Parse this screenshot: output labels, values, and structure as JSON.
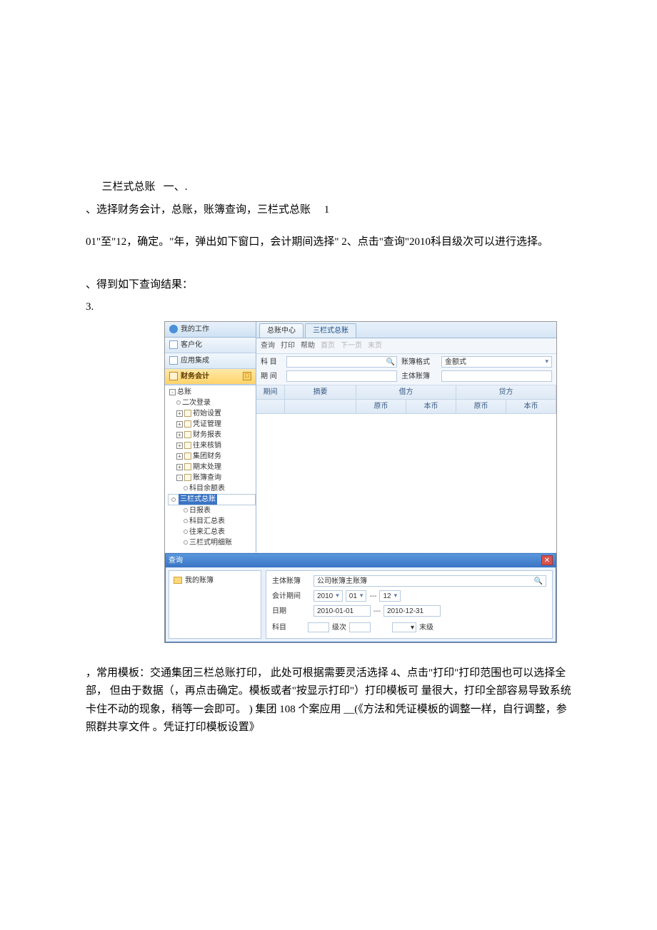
{
  "para1_a": "三栏式总账",
  "para1_b": "一、.",
  "para2_a": "、选择财务会计，总账，账簿查询，三栏式总账",
  "para2_b": "1",
  "para3": "01\"至\"12，确定。\"年，弹出如下窗口，会计期间选择\" 2、点击\"查询\"2010科目级次可以进行选择。",
  "para4_a": "、得到如下查询结果：",
  "para4_b": "3.",
  "para5": "，常用模板：交通集团三栏总账打印，  此处可根据需要灵活选择 4、点击\"打印\"打印范围也可以选择全部，  但由于数据（，再点击确定。模板或者\"按显示打印\"）打印模板可 量很大，打印全部容易导致系统卡住不动的现象，稍等一会即可。 ) 集团 108 个案应用 __(《方法和凭证模板的调整一样，自行调整，参照群共享文件 。凭证打印模板设置》",
  "nav": {
    "header": "我的工作",
    "items": [
      "客户化",
      "应用集成",
      "财务会计"
    ]
  },
  "tree": {
    "root": "总账",
    "children": [
      "二次登录",
      "初始设置",
      "凭证管理",
      "财务报表",
      "往来核销",
      "集团财务",
      "期末处理",
      "账簿查询"
    ],
    "sub": [
      "科目余额表",
      "三栏式总账",
      "日报表",
      "科目汇总表",
      "往来汇总表",
      "三栏式明细账"
    ]
  },
  "tabs": [
    "总账中心",
    "三栏式总账"
  ],
  "toolbar": [
    "查询",
    "打印",
    "帮助",
    "首页",
    "下一页",
    "末页"
  ],
  "filters": {
    "subject_label": "科 目",
    "period_label": "期 间",
    "fmt_label": "账簿格式",
    "fmt_value": "金额式",
    "cur_label": "主体账簿"
  },
  "grid": {
    "h1": [
      "期间",
      "摘要",
      "借方",
      "贷方"
    ],
    "h2": [
      "原币",
      "本币",
      "原币",
      "本币"
    ]
  },
  "dialog": {
    "title": "查询",
    "folder": "我的账簿",
    "r1_label": "主体账簿",
    "r1_value": "公司帐簿主账簿",
    "r2_label": "会计期间",
    "r2_year": "2010",
    "r2_from": "01",
    "r2_to": "12",
    "r3_label": "日期",
    "r3_from": "2010-01-01",
    "r3_to": "2010-12-31",
    "r4_a": "科目",
    "r4_b": "级次",
    "r4_c": "末级"
  }
}
